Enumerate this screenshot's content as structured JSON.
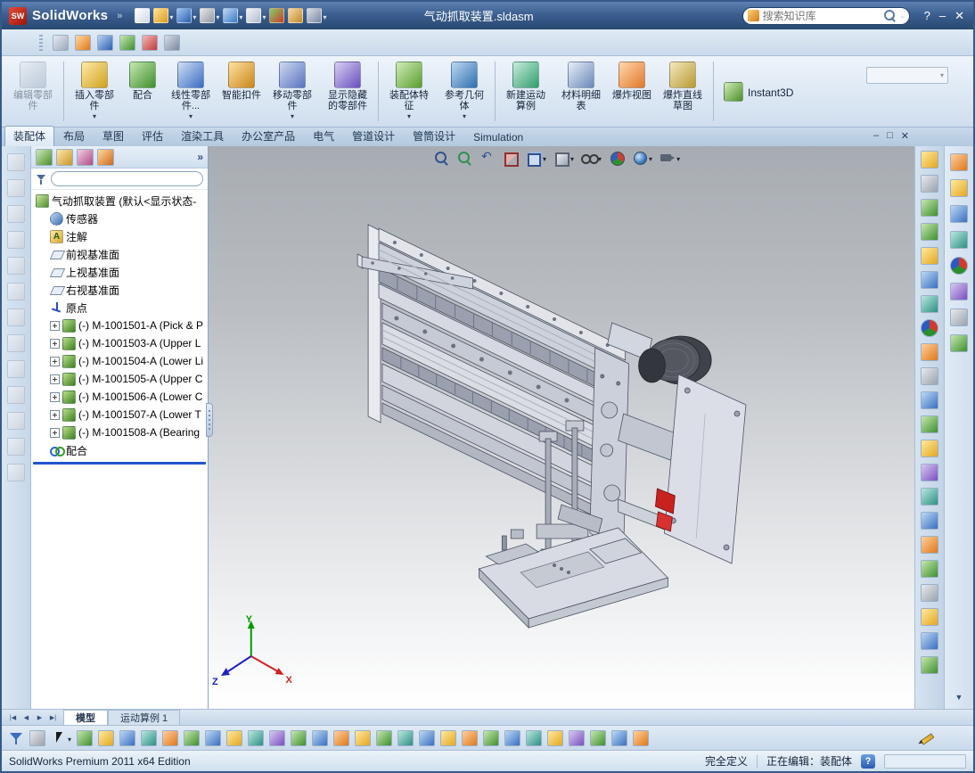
{
  "window": {
    "app_name": "SolidWorks",
    "logo_text": "SW",
    "menu_chevron": "»",
    "doc_title": "气动抓取装置.sldasm",
    "search_placeholder": "搜索知识库",
    "controls": {
      "help": "?",
      "minimize": "–",
      "close": "✕"
    }
  },
  "titlebar_tools": [
    {
      "name": "new-document-icon",
      "cls": "t-new"
    },
    {
      "name": "open-icon",
      "cls": "t-open",
      "caret": true
    },
    {
      "name": "save-icon",
      "cls": "t-save",
      "caret": true
    },
    {
      "name": "print-icon",
      "cls": "t-print",
      "caret": true
    },
    {
      "name": "undo-icon",
      "cls": "t-undo",
      "caret": true
    },
    {
      "name": "select-icon",
      "cls": "t-select",
      "caret": true
    },
    {
      "name": "rebuild-icon",
      "cls": "t-rebuild"
    },
    {
      "name": "file-properties-icon",
      "cls": "t-props"
    },
    {
      "name": "options-icon",
      "cls": "t-options",
      "caret": true
    }
  ],
  "quickbar_tools": [
    {
      "name": "sketch-flyout-icon",
      "cls": "q-a"
    },
    {
      "name": "arc-tool-icon",
      "cls": "q-b"
    },
    {
      "name": "spline-tool-icon",
      "cls": "q-c"
    },
    {
      "name": "trim-tool-icon",
      "cls": "q-d"
    },
    {
      "name": "convert-entities-icon",
      "cls": "q-e"
    },
    {
      "name": "customize-icon",
      "cls": "q-f"
    }
  ],
  "ribbon": {
    "items": [
      {
        "name": "edit-component-button",
        "label": "编辑零部件",
        "icon": "r-edit",
        "icon_name": "edit-component-icon",
        "cls": "disabled"
      },
      {
        "name": "ribbon-separator",
        "cls": "sep"
      },
      {
        "name": "insert-component-button",
        "label": "插入零部件",
        "icon": "r-insert",
        "icon_name": "insert-component-icon",
        "caret": true
      },
      {
        "name": "mate-button",
        "label": "配合",
        "icon": "r-mate",
        "icon_name": "mate-icon"
      },
      {
        "name": "linear-pattern-button",
        "label": "线性零部件...",
        "icon": "r-pattern",
        "icon_name": "linear-pattern-icon",
        "caret": true
      },
      {
        "name": "smart-fasteners-button",
        "label": "智能扣件",
        "icon": "r-fastener",
        "icon_name": "smart-fasteners-icon"
      },
      {
        "name": "move-component-button",
        "label": "移动零部件",
        "icon": "r-move",
        "icon_name": "move-component-icon",
        "caret": true
      },
      {
        "name": "show-hidden-components-button",
        "label": "显示隐藏的零部件",
        "icon": "r-hidden",
        "icon_name": "show-hidden-icon"
      },
      {
        "name": "ribbon-separator",
        "cls": "sep"
      },
      {
        "name": "assembly-features-button",
        "label": "装配体特征",
        "icon": "r-asmfeat",
        "icon_name": "assembly-features-icon",
        "caret": true
      },
      {
        "name": "reference-geometry-button",
        "label": "参考几何体",
        "icon": "r-refgeo",
        "icon_name": "reference-geometry-icon",
        "caret": true
      },
      {
        "name": "ribbon-separator",
        "cls": "sep"
      },
      {
        "name": "new-motion-study-button",
        "label": "新建运动算例",
        "icon": "r-motion",
        "icon_name": "new-motion-study-icon"
      },
      {
        "name": "bom-button",
        "label": "材料明细表",
        "icon": "r-bom",
        "icon_name": "bom-icon"
      },
      {
        "name": "exploded-view-button",
        "label": "爆炸视图",
        "icon": "r-explode",
        "icon_name": "exploded-view-icon"
      },
      {
        "name": "explode-line-sketch-button",
        "label": "爆炸直线草图",
        "icon": "r-expline",
        "icon_name": "explode-line-sketch-icon"
      },
      {
        "name": "ribbon-separator",
        "cls": "sep"
      },
      {
        "name": "instant3d-button",
        "label": "Instant3D",
        "icon": "r-i3d",
        "icon_name": "instant3d-icon",
        "cls": "wide"
      }
    ]
  },
  "command_tabs": {
    "items": [
      {
        "name": "tab-assembly",
        "label": "装配体",
        "cls": "active"
      },
      {
        "name": "tab-layout",
        "label": "布局"
      },
      {
        "name": "tab-sketch",
        "label": "草图"
      },
      {
        "name": "tab-evaluate",
        "label": "评估"
      },
      {
        "name": "tab-render-tools",
        "label": "渲染工具"
      },
      {
        "name": "tab-office-products",
        "label": "办公室产品"
      },
      {
        "name": "tab-electrical",
        "label": "电气"
      },
      {
        "name": "tab-piping",
        "label": "管道设计"
      },
      {
        "name": "tab-tubing",
        "label": "管筒设计"
      },
      {
        "name": "tab-simulation",
        "label": "Simulation"
      }
    ]
  },
  "tab_controls": {
    "minimize": "–",
    "restore": "□",
    "close": "✕"
  },
  "panel": {
    "tabs": [
      {
        "name": "featuremanager-tab-icon",
        "cls": "p-feat"
      },
      {
        "name": "propertymanager-tab-icon",
        "cls": "p-prop"
      },
      {
        "name": "configurationmanager-tab-icon",
        "cls": "p-conf"
      },
      {
        "name": "displaymanager-tab-icon",
        "cls": "p-disp"
      }
    ],
    "chevron": "»",
    "filter_value": "",
    "tree": {
      "root": "气动抓取装置 (默认<显示状态-",
      "items": [
        {
          "name": "tree-item-sensors",
          "label": "传感器",
          "icon": "ti-sensors",
          "icon_name": "sensors-icon"
        },
        {
          "name": "tree-item-annotations",
          "label": "注解",
          "icon": "ti-ann",
          "icon_name": "annotations-icon"
        },
        {
          "name": "tree-item-front-plane",
          "label": "前视基准面",
          "icon": "ti-plane",
          "icon_name": "plane-icon"
        },
        {
          "name": "tree-item-top-plane",
          "label": "上视基准面",
          "icon": "ti-plane",
          "icon_name": "plane-icon"
        },
        {
          "name": "tree-item-right-plane",
          "label": "右视基准面",
          "icon": "ti-plane",
          "icon_name": "plane-icon"
        },
        {
          "name": "tree-item-origin",
          "label": "原点",
          "icon": "ti-origin",
          "icon_name": "origin-icon"
        },
        {
          "name": "tree-item-m1001501",
          "label": "(-) M-1001501-A (Pick & P",
          "icon": "ti-comp",
          "icon_name": "component-icon",
          "exp": true
        },
        {
          "name": "tree-item-m1001503",
          "label": "(-) M-1001503-A (Upper L",
          "icon": "ti-comp",
          "icon_name": "component-icon",
          "exp": true
        },
        {
          "name": "tree-item-m1001504",
          "label": "(-) M-1001504-A (Lower Li",
          "icon": "ti-comp",
          "icon_name": "component-icon",
          "exp": true
        },
        {
          "name": "tree-item-m1001505",
          "label": "(-) M-1001505-A (Upper C",
          "icon": "ti-comp",
          "icon_name": "component-icon",
          "exp": true
        },
        {
          "name": "tree-item-m1001506",
          "label": "(-) M-1001506-A (Lower C",
          "icon": "ti-comp",
          "icon_name": "component-icon",
          "exp": true
        },
        {
          "name": "tree-item-m1001507",
          "label": "(-) M-1001507-A (Lower T",
          "icon": "ti-comp",
          "icon_name": "component-icon",
          "exp": true
        },
        {
          "name": "tree-item-m1001508",
          "label": "(-) M-1001508-A (Bearing",
          "icon": "ti-comp",
          "icon_name": "component-icon",
          "exp": true
        },
        {
          "name": "tree-item-mates",
          "label": "配合",
          "icon": "ti-mates",
          "icon_name": "mates-icon"
        }
      ]
    }
  },
  "left_toolbar": {
    "icons": [
      {
        "name": "left-toolbar-icon"
      },
      {
        "name": "left-toolbar-icon"
      },
      {
        "name": "left-toolbar-icon"
      },
      {
        "name": "left-toolbar-icon"
      },
      {
        "name": "left-toolbar-icon"
      },
      {
        "name": "left-toolbar-icon"
      },
      {
        "name": "left-toolbar-icon"
      },
      {
        "name": "left-toolbar-icon"
      },
      {
        "name": "left-toolbar-icon"
      },
      {
        "name": "left-toolbar-icon"
      },
      {
        "name": "left-toolbar-icon"
      },
      {
        "name": "left-toolbar-icon"
      },
      {
        "name": "left-toolbar-icon"
      }
    ]
  },
  "hud": {
    "icons": [
      {
        "name": "zoom-fit-icon",
        "cls": "h-magfit"
      },
      {
        "name": "zoom-area-icon",
        "cls": "h-magarea"
      },
      {
        "name": "previous-view-icon",
        "cls": "h-prev"
      },
      {
        "name": "section-view-icon",
        "cls": "h-section"
      },
      {
        "name": "view-orientation-icon",
        "cls": "h-cube",
        "caret": true
      },
      {
        "name": "display-style-icon",
        "cls": "h-style",
        "caret": true
      },
      {
        "name": "hide-show-items-icon",
        "cls": "h-eye",
        "caret": true
      },
      {
        "name": "edit-appearance-icon",
        "cls": "h-ball"
      },
      {
        "name": "apply-scene-icon",
        "cls": "h-scene",
        "caret": true
      },
      {
        "name": "view-settings-icon",
        "cls": "h-cam",
        "caret": true
      }
    ]
  },
  "right_inner_toolbar": {
    "icons": [
      {
        "name": "right-toolbar-icon",
        "cls": "c-yellow"
      },
      {
        "name": "right-toolbar-icon",
        "cls": "c-gray"
      },
      {
        "name": "right-toolbar-icon",
        "cls": "c-green"
      },
      {
        "name": "right-toolbar-icon",
        "cls": "c-green"
      },
      {
        "name": "right-toolbar-icon",
        "cls": "c-yellow"
      },
      {
        "name": "right-toolbar-icon",
        "cls": "c-blue"
      },
      {
        "name": "right-toolbar-icon",
        "cls": "c-teal"
      },
      {
        "name": "right-toolbar-icon",
        "cls": "ball"
      },
      {
        "name": "right-toolbar-icon",
        "cls": "c-orange"
      },
      {
        "name": "right-toolbar-icon",
        "cls": "c-gray"
      },
      {
        "name": "right-toolbar-icon",
        "cls": "c-blue"
      },
      {
        "name": "right-toolbar-icon",
        "cls": "c-green"
      },
      {
        "name": "right-toolbar-icon",
        "cls": "c-yellow"
      },
      {
        "name": "right-toolbar-icon",
        "cls": "c-purple"
      },
      {
        "name": "right-toolbar-icon",
        "cls": "c-teal"
      },
      {
        "name": "right-toolbar-icon",
        "cls": "c-blue"
      },
      {
        "name": "right-toolbar-icon",
        "cls": "c-orange"
      },
      {
        "name": "right-toolbar-icon",
        "cls": "c-green"
      },
      {
        "name": "right-toolbar-icon",
        "cls": "c-gray"
      },
      {
        "name": "right-toolbar-icon",
        "cls": "c-yellow"
      },
      {
        "name": "right-toolbar-icon",
        "cls": "c-blue"
      },
      {
        "name": "right-toolbar-icon",
        "cls": "c-green"
      }
    ]
  },
  "task_pane": {
    "icons": [
      {
        "name": "solidworks-resources-icon",
        "cls": "c-orange"
      },
      {
        "name": "design-library-icon",
        "cls": "c-yellow"
      },
      {
        "name": "file-explorer-icon",
        "cls": "c-blue"
      },
      {
        "name": "view-palette-icon",
        "cls": "c-teal"
      },
      {
        "name": "appearances-icon",
        "cls": "ball"
      },
      {
        "name": "scenes-icon",
        "cls": "c-purple"
      },
      {
        "name": "custom-properties-icon",
        "cls": "c-gray"
      },
      {
        "name": "document-recovery-icon",
        "cls": "c-green"
      }
    ],
    "more_glyph": "▼"
  },
  "graphics": {
    "triad": {
      "x": "X",
      "y": "Y",
      "z": "Z"
    }
  },
  "bottom_tabs": {
    "nav": [
      {
        "name": "first-tab-button",
        "glyph": "|◀"
      },
      {
        "name": "prev-tab-button",
        "glyph": "◀"
      },
      {
        "name": "next-tab-button",
        "glyph": "▶"
      },
      {
        "name": "last-tab-button",
        "glyph": "▶|"
      }
    ],
    "items": [
      {
        "name": "tab-model",
        "label": "模型",
        "cls": "active"
      },
      {
        "name": "tab-motion-study-1",
        "label": "运动算例 1"
      }
    ]
  },
  "bottom_toolbar": {
    "icons": [
      {
        "name": "selection-filter-icon",
        "cls": "b-funnel"
      },
      {
        "name": "filter-box-icon",
        "cls": "c-gray"
      },
      {
        "name": "select-cursor-icon",
        "cls": "b-cursor",
        "caret": true
      },
      {
        "name": "tool-icon",
        "cls": "c-green"
      },
      {
        "name": "tool-icon",
        "cls": "c-yellow"
      },
      {
        "name": "tool-icon",
        "cls": "c-blue"
      },
      {
        "name": "tool-icon",
        "cls": "c-teal"
      },
      {
        "name": "tool-icon",
        "cls": "c-orange"
      },
      {
        "name": "tool-icon",
        "cls": "c-green"
      },
      {
        "name": "tool-icon",
        "cls": "c-blue"
      },
      {
        "name": "tool-icon",
        "cls": "c-yellow"
      },
      {
        "name": "tool-icon",
        "cls": "c-teal"
      },
      {
        "name": "tool-icon",
        "cls": "c-purple"
      },
      {
        "name": "tool-icon",
        "cls": "c-green"
      },
      {
        "name": "tool-icon",
        "cls": "c-blue"
      },
      {
        "name": "tool-icon",
        "cls": "c-orange"
      },
      {
        "name": "tool-icon",
        "cls": "c-yellow"
      },
      {
        "name": "tool-icon",
        "cls": "c-green"
      },
      {
        "name": "tool-icon",
        "cls": "c-teal"
      },
      {
        "name": "tool-icon",
        "cls": "c-blue"
      },
      {
        "name": "tool-icon",
        "cls": "c-yellow"
      },
      {
        "name": "tool-icon",
        "cls": "c-orange"
      },
      {
        "name": "tool-icon",
        "cls": "c-green"
      },
      {
        "name": "tool-icon",
        "cls": "c-blue"
      },
      {
        "name": "tool-icon",
        "cls": "c-teal"
      },
      {
        "name": "tool-icon",
        "cls": "c-yellow"
      },
      {
        "name": "tool-icon",
        "cls": "c-purple"
      },
      {
        "name": "tool-icon",
        "cls": "c-green"
      },
      {
        "name": "tool-icon",
        "cls": "c-blue"
      },
      {
        "name": "tool-icon",
        "cls": "c-orange"
      }
    ]
  },
  "statusbar": {
    "product": "SolidWorks Premium 2011 x64 Edition",
    "defined_state": "完全定义",
    "editing_state": "正在编辑：装配体",
    "help_glyph": "?"
  },
  "colors": {
    "titlebar_top": "#5d81b0",
    "titlebar_bottom": "#28496f",
    "rollback_accent": "#2255cc",
    "graphics_top": "#a7acb2"
  }
}
